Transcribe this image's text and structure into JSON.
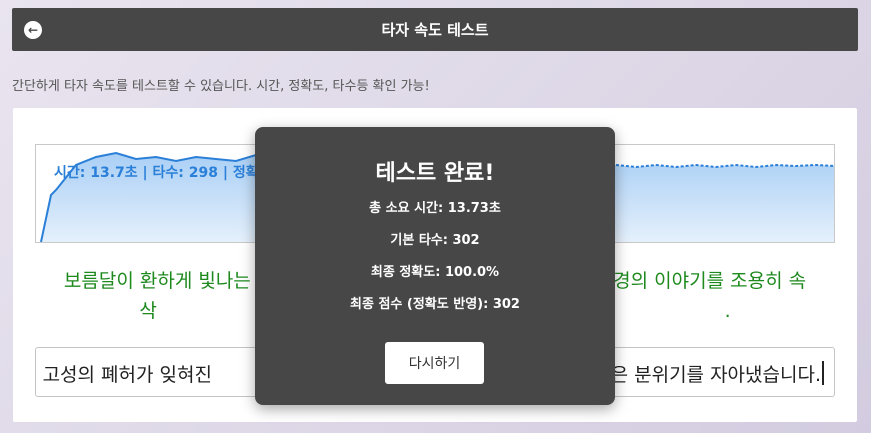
{
  "header": {
    "title": "타자 속도 테스트",
    "back_icon": "back-arrow-icon",
    "back_glyph": "←"
  },
  "description": "간단하게 타자 속도를 테스트할 수 있습니다. 시간, 정확도, 타수등 확인 가능!",
  "graph": {
    "stats_text": "시간: 13.7초 | 타수: 298 | 정확",
    "color": "#2a7fd8"
  },
  "target_text": {
    "line1": "보름달이 환하게 빛나는                                                            경의 이야기를 조용히 속",
    "line2": "삭                                                                                              ."
  },
  "typing": {
    "value": "ㄹ운 고성의 폐허가 잊혀진                                                                  은 분위기를 자아냈습니다."
  },
  "modal": {
    "title": "테스트 완료!",
    "total_time": "총 소요 시간: 13.73초",
    "base_wpm": "기본 타수: 302",
    "final_accuracy": "최종 정확도: 100.0%",
    "final_score": "최종 점수 (정확도 반영): 302",
    "retry_label": "다시하기"
  },
  "colors": {
    "header_bg": "#474747",
    "target_text": "#1e8a1e",
    "modal_bg": "#474747"
  }
}
